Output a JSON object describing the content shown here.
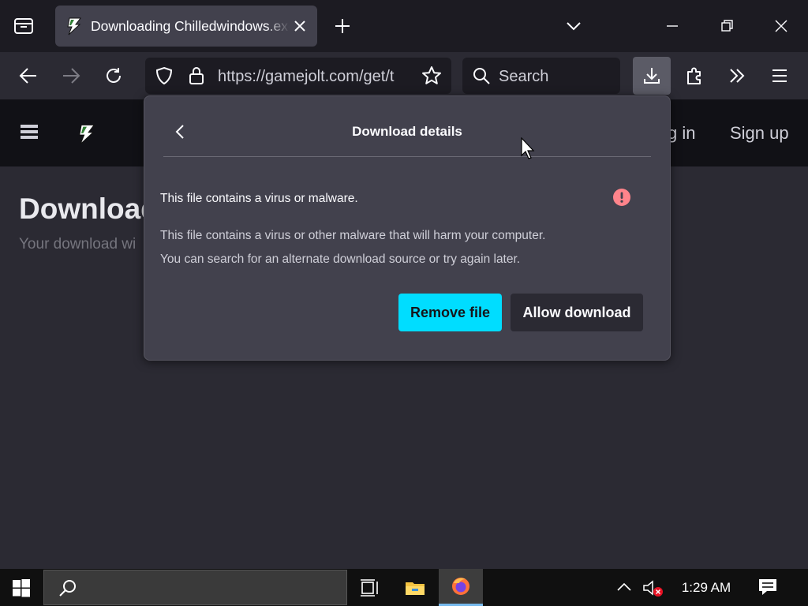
{
  "browser": {
    "tab": {
      "title": "Downloading Chilledwindows.exe"
    },
    "url": "https://gamejolt.com/get/t",
    "search_placeholder": "Search"
  },
  "site": {
    "header_links": {
      "login": "g in",
      "signup": "Sign up"
    },
    "page_title": "Download",
    "page_subtitle": "Your download wi"
  },
  "download_panel": {
    "title": "Download details",
    "status": "This file contains a virus or malware.",
    "description": [
      "This file contains a virus or other malware that will harm your computer.",
      "You can search for an alternate download source or try again later."
    ],
    "remove_label": "Remove file",
    "allow_label": "Allow download",
    "colors": {
      "primary_button": "#00ddff",
      "alert": "#ff848b"
    }
  },
  "taskbar": {
    "clock": "1:29 AM",
    "apps": [
      "task-view",
      "file-explorer",
      "firefox"
    ]
  }
}
